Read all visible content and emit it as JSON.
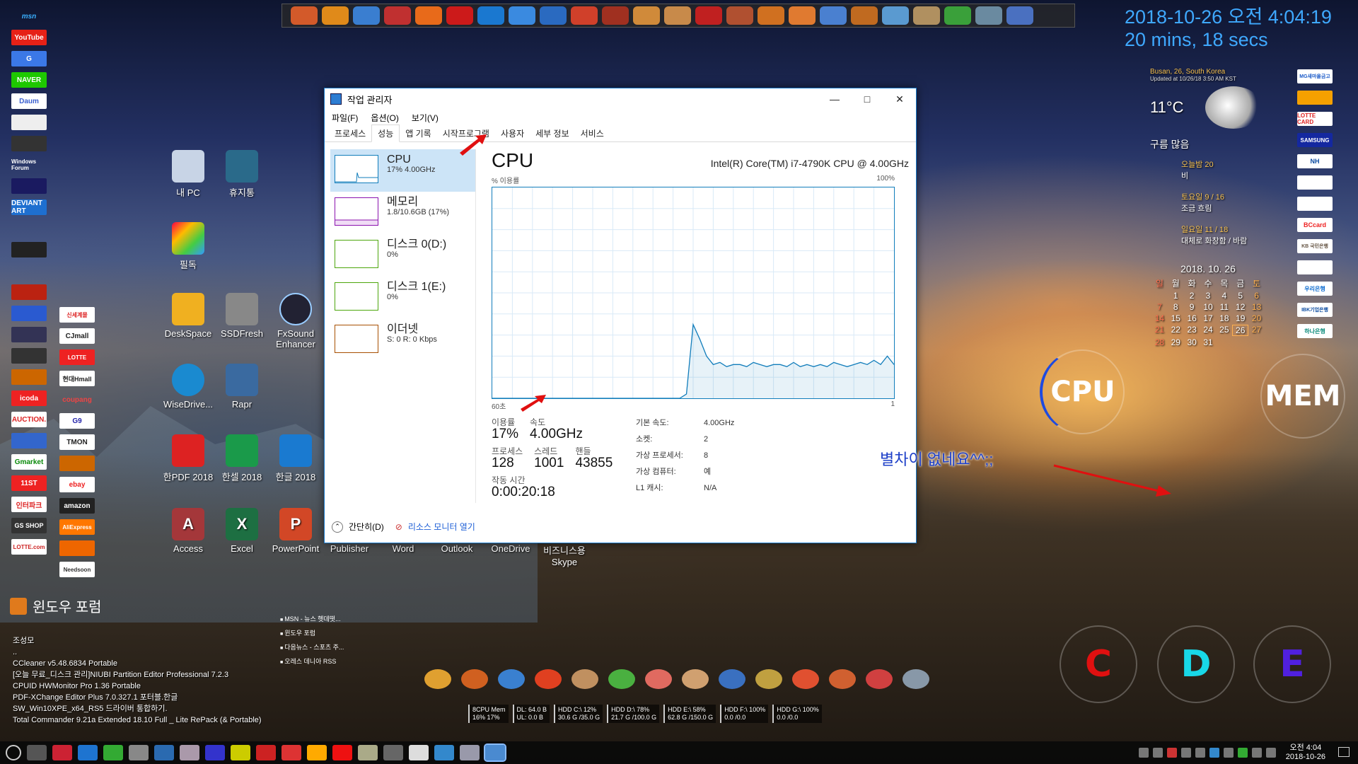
{
  "desktop": {
    "clock": {
      "line1": "2018-10-26 오전 4:04:19",
      "line2": "20 mins, 18 secs"
    },
    "annotation": "별차이 없네요^^;;",
    "left_brands": [
      "msn",
      "YouTube",
      "G",
      "NAVER",
      "Daum",
      "",
      "",
      "Windows Forum",
      "",
      "DEVIANT ART",
      "",
      "",
      "",
      "",
      "",
      "",
      "",
      "",
      "icoda",
      "AUCTION.",
      "",
      "Gmarket",
      "11ST",
      "인터파크",
      "GS SHOP",
      "LOTTE.com"
    ],
    "left_brands2": [
      "신세계몰",
      "CJmall",
      "LOTTE",
      "현대Hmall",
      "coupang",
      "G9",
      "TMON",
      "",
      "ebay",
      "amazon",
      "AliExpress",
      "",
      "Needsoon"
    ],
    "icons": [
      {
        "label": "내 PC"
      },
      {
        "label": "휴지통"
      },
      {
        "label": "필독"
      },
      {
        "label": "DeskSpace"
      },
      {
        "label": "SSDFresh"
      },
      {
        "label": "FxSound Enhancer"
      },
      {
        "label": "WiseDrive..."
      },
      {
        "label": "Rapr"
      },
      {
        "label": "한PDF 2018"
      },
      {
        "label": "한셀 2018"
      },
      {
        "label": "한글 2018"
      },
      {
        "label": "Access"
      },
      {
        "label": "Excel"
      },
      {
        "label": "PowerPoint"
      },
      {
        "label": "Publisher"
      },
      {
        "label": "Word"
      },
      {
        "label": "Outlook"
      },
      {
        "label": "OneDrive"
      },
      {
        "label": "비즈니스용 Skype"
      }
    ]
  },
  "task_manager": {
    "title": "작업 관리자",
    "window_controls": {
      "minimize": "—",
      "maximize": "□",
      "close": "✕"
    },
    "menu": [
      "파일(F)",
      "옵션(O)",
      "보기(V)"
    ],
    "tabs": [
      "프로세스",
      "성능",
      "앱 기록",
      "시작프로그램",
      "사용자",
      "세부 정보",
      "서비스"
    ],
    "active_tab": "성능",
    "resources": [
      {
        "name": "CPU",
        "sub": "17% 4.00GHz",
        "color": "#117dbb"
      },
      {
        "name": "메모리",
        "sub": "1.8/10.6GB (17%)",
        "color": "#8b12ae"
      },
      {
        "name": "디스크 0(D:)",
        "sub": "0%",
        "color": "#4da60c"
      },
      {
        "name": "디스크 1(E:)",
        "sub": "0%",
        "color": "#4da60c"
      },
      {
        "name": "이더넷",
        "sub": "S: 0 R: 0 Kbps",
        "color": "#a74f01"
      }
    ],
    "cpu": {
      "heading": "CPU",
      "model": "Intel(R) Core(TM) i7-4790K CPU @ 4.00GHz",
      "usage_label": "% 이용률",
      "max_label": "100%",
      "time_label": "60초",
      "zero_label": "1",
      "utilization_label": "이용률",
      "utilization": "17%",
      "speed_label": "속도",
      "speed": "4.00GHz",
      "processes_label": "프로세스",
      "processes": "128",
      "threads_label": "스레드",
      "threads": "1001",
      "handles_label": "핸들",
      "handles": "43855",
      "uptime_label": "작동 시간",
      "uptime": "0:00:20:18",
      "details": [
        {
          "k": "기본 속도:",
          "v": "4.00GHz"
        },
        {
          "k": "소켓:",
          "v": "2"
        },
        {
          "k": "가상 프로세서:",
          "v": "8"
        },
        {
          "k": "가상 컴퓨터:",
          "v": "예"
        },
        {
          "k": "L1 캐시:",
          "v": "N/A"
        }
      ]
    },
    "footer": {
      "fewer": "간단히(D)",
      "monitor": "리소스 모니터 열기"
    }
  },
  "chart_data": {
    "type": "area",
    "title": "CPU",
    "ylabel": "% 이용률",
    "ylim": [
      0,
      100
    ],
    "x": [
      0,
      28,
      29,
      30,
      31,
      32,
      33,
      34,
      35,
      36,
      37,
      38,
      39,
      40,
      41,
      42,
      43,
      44,
      45,
      46,
      47,
      48,
      49,
      50,
      51,
      52,
      53,
      54,
      55,
      56,
      57,
      58,
      59,
      60
    ],
    "series": [
      {
        "values": [
          0,
          0,
          2,
          35,
          28,
          20,
          16,
          17,
          15,
          16,
          16,
          15,
          17,
          16,
          15,
          16,
          16,
          15,
          17,
          15,
          16,
          15,
          16,
          15,
          17,
          16,
          15,
          16,
          17,
          16,
          18,
          16,
          20,
          16
        ]
      }
    ]
  },
  "weather": {
    "location": "Busan, 26, South Korea",
    "updated": "Updated at 10/26/18 3:50 AM KST",
    "temp": "11°C",
    "condition": "구름 많음",
    "forecast": [
      {
        "day": "오늘밤 20",
        "desc": "비"
      },
      {
        "day": "토요일 9 / 16",
        "desc": "조금 흐림"
      },
      {
        "day": "일요일 11 / 18",
        "desc": "대체로 화창함 / 바람"
      }
    ]
  },
  "calendar": {
    "title": "2018. 10. 26",
    "weekdays": [
      "일",
      "월",
      "화",
      "수",
      "목",
      "금",
      "토"
    ],
    "days": [
      "",
      "1",
      "2",
      "3",
      "4",
      "5",
      "6",
      "7",
      "8",
      "9",
      "10",
      "11",
      "12",
      "13",
      "14",
      "15",
      "16",
      "17",
      "18",
      "19",
      "20",
      "21",
      "22",
      "23",
      "24",
      "25",
      "26",
      "27",
      "28",
      "29",
      "30",
      "31"
    ]
  },
  "banks": [
    "MG새마을금고",
    "",
    "LOTTE CARD",
    "SAMSUNG",
    "NH",
    "",
    "",
    "BCcard",
    "KB 국민은행",
    "",
    "우리은행",
    "IBK기업은행",
    "하나은행"
  ],
  "gauges": [
    "CPU",
    "MEM",
    "C",
    "D",
    "E"
  ],
  "rss": {
    "title": "윈도우 포럼",
    "author": "조성모",
    "items": [
      "MSN - 뉴스 헷데떳...",
      "윈도우 포럼",
      "다음뉴스 - 스포츠 주...",
      "오레스 데니아 RSS"
    ],
    "notes": [
      "..",
      "CCleaner v5.48.6834 Portable",
      "[오늘 무료_디스크 관리]NIUBI Partition Editor Professional 7.2.3",
      "CPUID HWMonitor Pro 1.36 Portable",
      "PDF-XChange Editor Plus 7.0.327.1 포터블.한글",
      "SW_Win10XPE_x64_RS5 드라이버 통합하기.",
      "Total Commander 9.21a Extended 18.10 Full _ Lite RePack (& Portable)"
    ]
  },
  "meters": [
    {
      "l1": "8CPU  Mem",
      "l2": "16%   17%"
    },
    {
      "l1": "DL:   64.0 B",
      "l2": "UL:   0.0 B"
    },
    {
      "l1": "HDD C:\\  12%",
      "l2": "30.6 G /35.0 G"
    },
    {
      "l1": "HDD D:\\  78%",
      "l2": "21.7 G /100.0 G"
    },
    {
      "l1": "HDD E:\\  58%",
      "l2": "62.8 G /150.0 G"
    },
    {
      "l1": "HDD F:\\  100%",
      "l2": "0.0  /0.0"
    },
    {
      "l1": "HDD G:\\  100%",
      "l2": "0.0  /0.0"
    }
  ],
  "taskbar": {
    "time": "오전 4:04",
    "date": "2018-10-26"
  }
}
